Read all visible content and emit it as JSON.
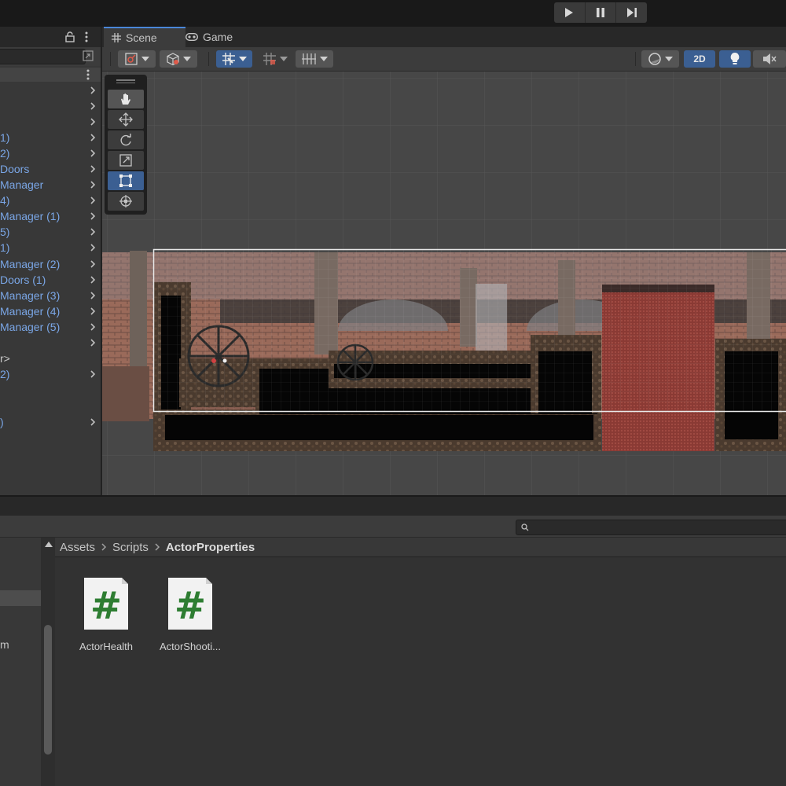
{
  "colors": {
    "accent": "#4a87d9",
    "selected_tool": "#3b5f92",
    "hierarchy_prefab_text": "#7aa6e6",
    "script_icon_green": "#2e7d32"
  },
  "toolbar": {
    "play_icon": "play-icon",
    "pause_icon": "pause-icon",
    "step_icon": "step-icon"
  },
  "hierarchy": {
    "rows": [
      {
        "label": "",
        "prefab": false
      },
      {
        "label": "",
        "prefab": false
      },
      {
        "label": "",
        "prefab": false
      },
      {
        "label": "1)",
        "prefab": true
      },
      {
        "label": "2)",
        "prefab": true
      },
      {
        "label": "Doors",
        "prefab": true
      },
      {
        "label": "Manager",
        "prefab": true
      },
      {
        "label": "4)",
        "prefab": true
      },
      {
        "label": "Manager (1)",
        "prefab": true
      },
      {
        "label": "5)",
        "prefab": true
      },
      {
        "label": "1)",
        "prefab": true
      },
      {
        "label": "Manager (2)",
        "prefab": true
      },
      {
        "label": "Doors (1)",
        "prefab": true
      },
      {
        "label": "Manager (3)",
        "prefab": true
      },
      {
        "label": "Manager (4)",
        "prefab": true
      },
      {
        "label": "Manager (5)",
        "prefab": true
      },
      {
        "label": "",
        "prefab": false
      },
      {
        "label": "r>",
        "prefab": false
      },
      {
        "label": "2)",
        "prefab": true
      },
      {
        "label": "",
        "prefab": false
      },
      {
        "label": ")",
        "prefab": true
      }
    ]
  },
  "scene": {
    "tabs": [
      {
        "label": "Scene",
        "icon": "grid-icon",
        "active": true
      },
      {
        "label": "Game",
        "icon": "gamepad-icon",
        "active": false
      }
    ],
    "toolbar": {
      "mode_2d_label": "2D"
    },
    "tools": [
      "hand-tool",
      "move-tool",
      "rotate-tool",
      "scale-tool",
      "rect-tool",
      "transform-tool"
    ],
    "selected_tool": "rect-tool"
  },
  "project": {
    "breadcrumb": [
      "Assets",
      "Scripts",
      "ActorProperties"
    ],
    "tree_partial_label": "m",
    "assets": [
      {
        "name": "ActorHealth",
        "icon": "csharp-script-icon"
      },
      {
        "name": "ActorShooti...",
        "icon": "csharp-script-icon"
      }
    ]
  }
}
